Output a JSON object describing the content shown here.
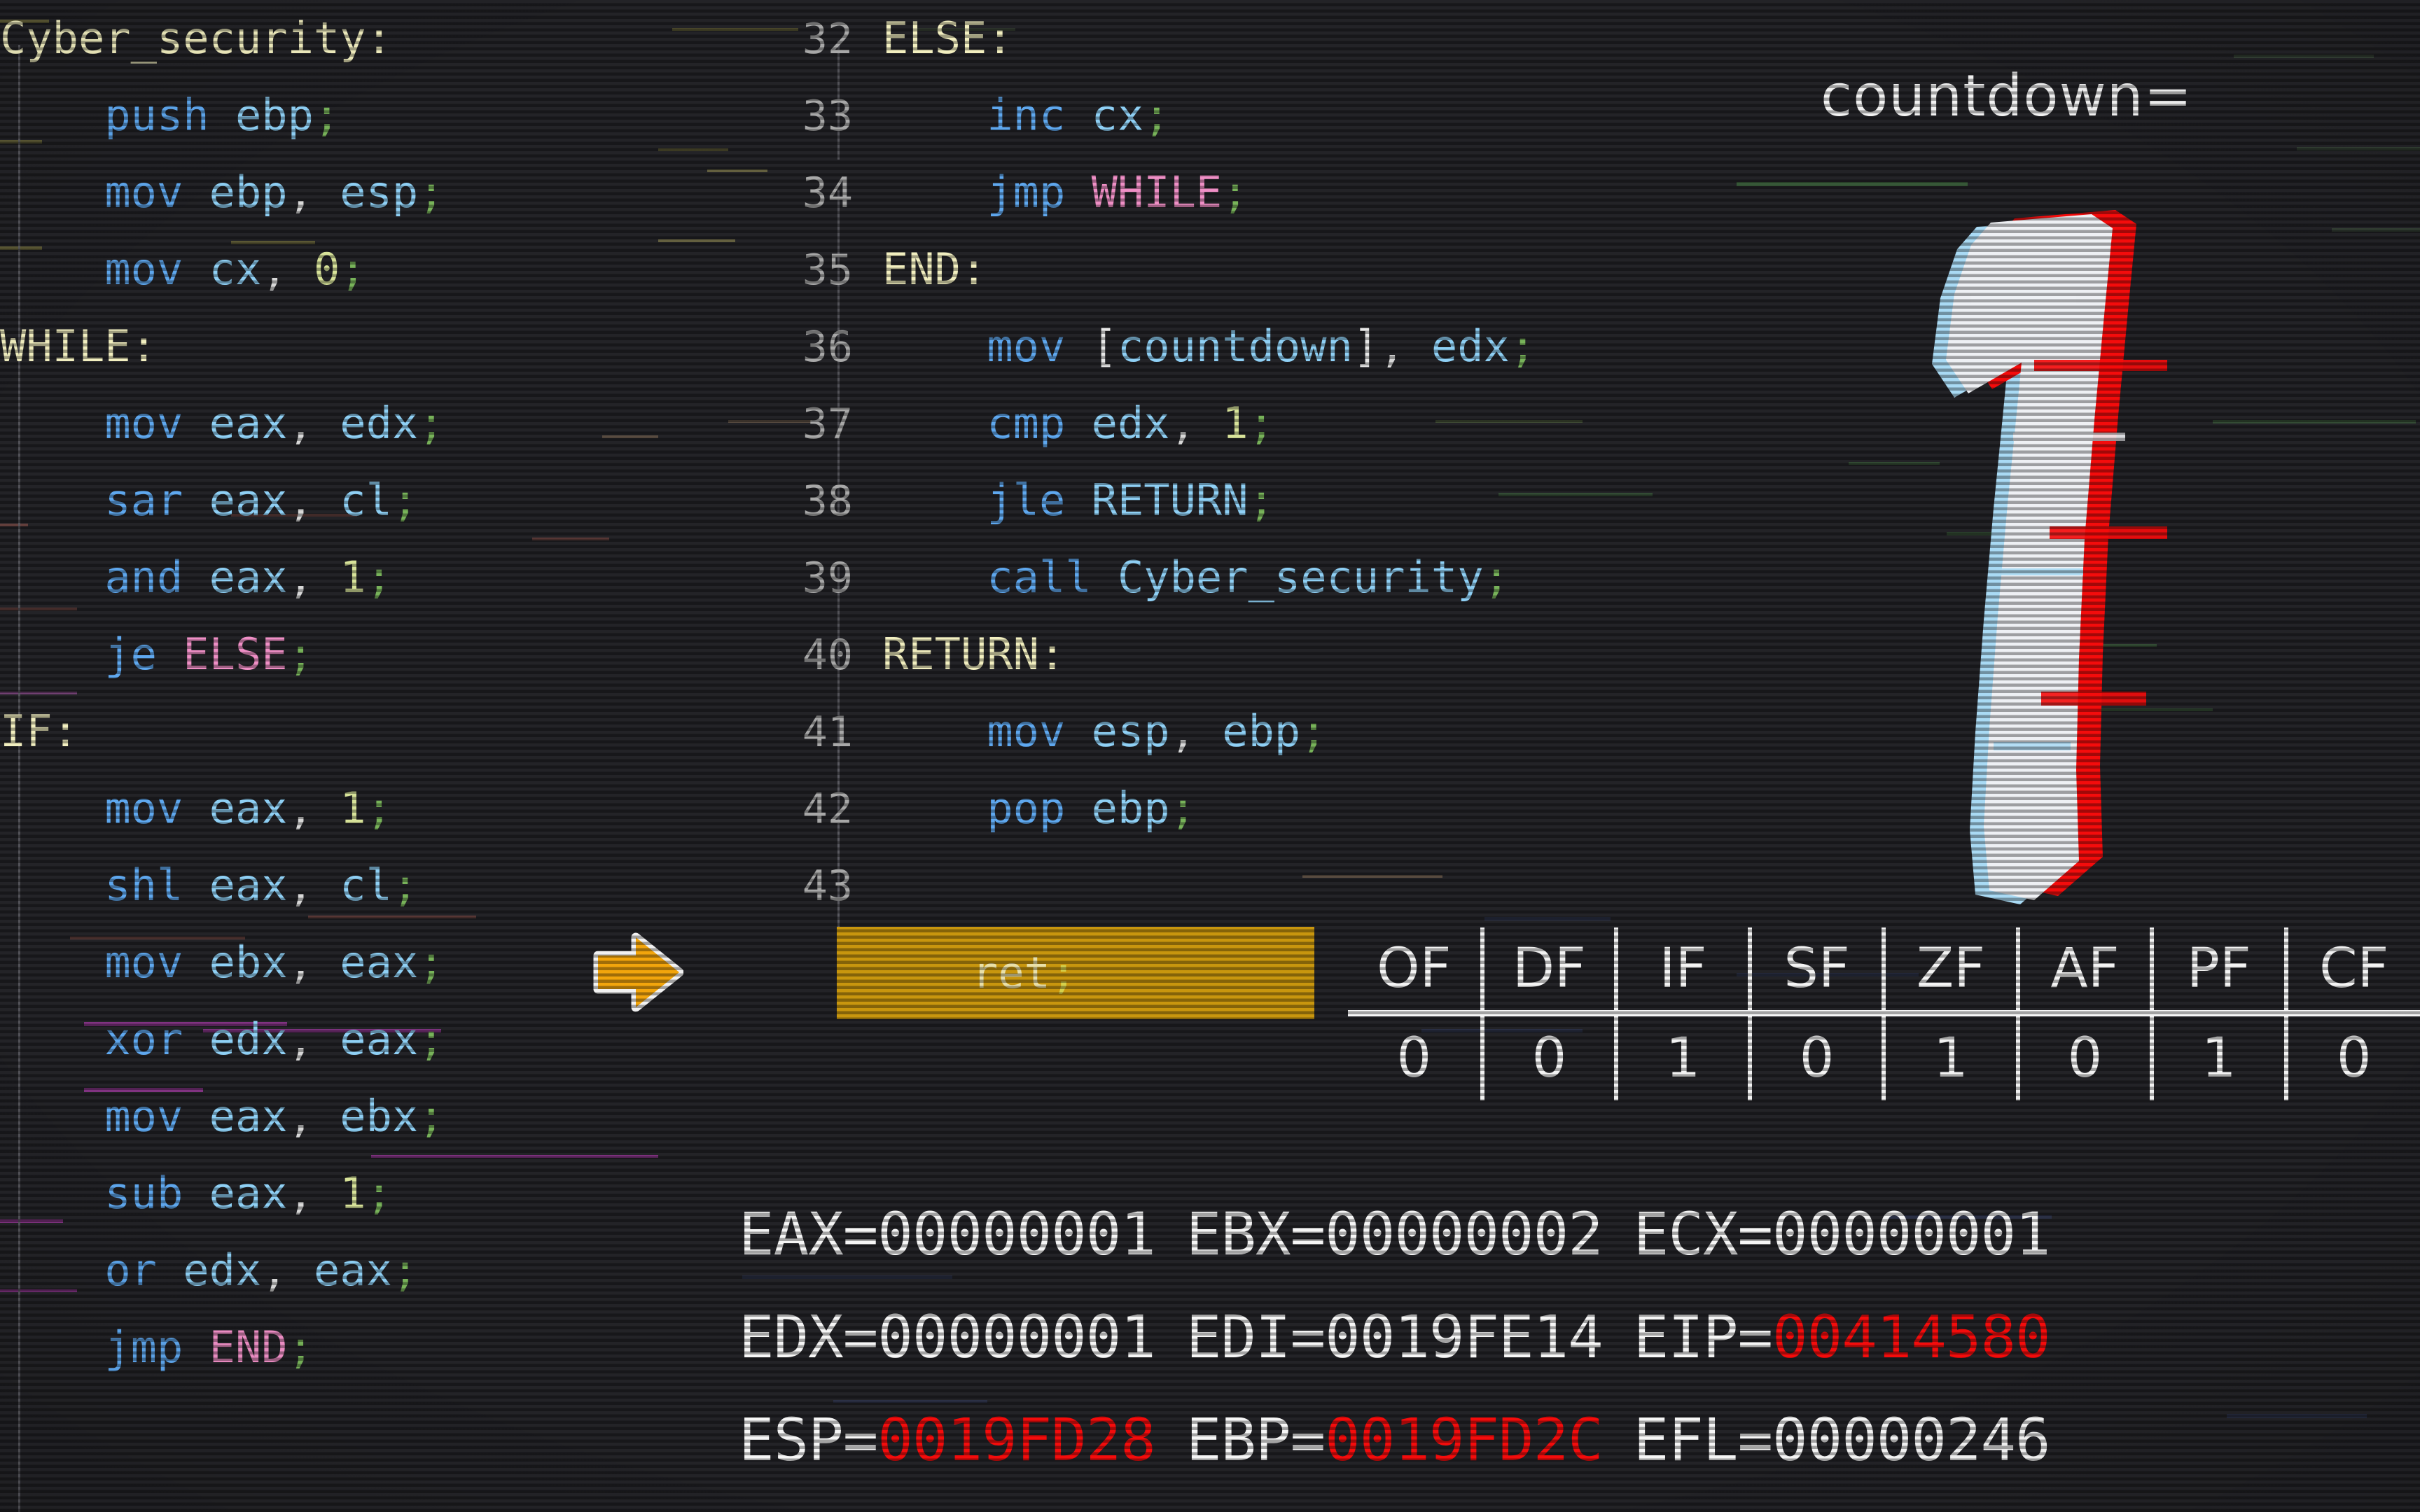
{
  "background": {
    "base_color": "#232327",
    "scanlines": true
  },
  "theme": {
    "label_color": "#f2efc0",
    "mnemonic_color": "#5fa8ef",
    "register_color": "#8fd0f5",
    "number_color": "#d8e39a",
    "semicolon_color": "#78b35a",
    "jump_target_color": "#ef8fc6",
    "line_number_color": "#a8a8a8",
    "exec_highlight_color": "#c8960e",
    "exec_arrow_color": "#f2a50c",
    "register_hot_color": "#f40c0c",
    "register_text_color": "#f6f6f6"
  },
  "code_left": [
    {
      "indent": 0,
      "parts": [
        {
          "t": "Cyber_security:",
          "c": "lbl"
        }
      ]
    },
    {
      "indent": 1,
      "parts": [
        {
          "t": "push ",
          "c": "mn"
        },
        {
          "t": "ebp",
          "c": "reg"
        },
        {
          "t": ";",
          "c": "semi"
        }
      ]
    },
    {
      "indent": 1,
      "parts": [
        {
          "t": "mov ",
          "c": "mn"
        },
        {
          "t": "ebp",
          "c": "reg"
        },
        {
          "t": ",",
          "c": "punct"
        },
        {
          "t": " ",
          "c": "punct"
        },
        {
          "t": "esp",
          "c": "reg"
        },
        {
          "t": ";",
          "c": "semi"
        }
      ]
    },
    {
      "indent": 1,
      "parts": [
        {
          "t": "mov ",
          "c": "mn"
        },
        {
          "t": "cx",
          "c": "reg"
        },
        {
          "t": ",",
          "c": "punct"
        },
        {
          "t": " ",
          "c": "punct"
        },
        {
          "t": "0",
          "c": "num"
        },
        {
          "t": ";",
          "c": "semi"
        }
      ]
    },
    {
      "indent": 0,
      "parts": [
        {
          "t": "WHILE:",
          "c": "lbl"
        }
      ]
    },
    {
      "indent": 1,
      "parts": [
        {
          "t": "mov ",
          "c": "mn"
        },
        {
          "t": "eax",
          "c": "reg"
        },
        {
          "t": ",",
          "c": "punct"
        },
        {
          "t": " ",
          "c": "punct"
        },
        {
          "t": "edx",
          "c": "reg"
        },
        {
          "t": ";",
          "c": "semi"
        }
      ]
    },
    {
      "indent": 1,
      "parts": [
        {
          "t": "sar ",
          "c": "mn"
        },
        {
          "t": "eax",
          "c": "reg"
        },
        {
          "t": ",",
          "c": "punct"
        },
        {
          "t": " ",
          "c": "punct"
        },
        {
          "t": "cl",
          "c": "reg"
        },
        {
          "t": ";",
          "c": "semi"
        }
      ]
    },
    {
      "indent": 1,
      "parts": [
        {
          "t": "and ",
          "c": "mn"
        },
        {
          "t": "eax",
          "c": "reg"
        },
        {
          "t": ",",
          "c": "punct"
        },
        {
          "t": " ",
          "c": "punct"
        },
        {
          "t": "1",
          "c": "num"
        },
        {
          "t": ";",
          "c": "semi"
        }
      ]
    },
    {
      "indent": 1,
      "parts": [
        {
          "t": "je ",
          "c": "mn"
        },
        {
          "t": "ELSE",
          "c": "ref"
        },
        {
          "t": ";",
          "c": "semi"
        }
      ]
    },
    {
      "indent": 0,
      "parts": [
        {
          "t": "IF:",
          "c": "lbl"
        }
      ]
    },
    {
      "indent": 1,
      "parts": [
        {
          "t": "mov ",
          "c": "mn"
        },
        {
          "t": "eax",
          "c": "reg"
        },
        {
          "t": ",",
          "c": "punct"
        },
        {
          "t": " ",
          "c": "punct"
        },
        {
          "t": "1",
          "c": "num"
        },
        {
          "t": ";",
          "c": "semi"
        }
      ]
    },
    {
      "indent": 1,
      "parts": [
        {
          "t": "shl ",
          "c": "mn"
        },
        {
          "t": "eax",
          "c": "reg"
        },
        {
          "t": ",",
          "c": "punct"
        },
        {
          "t": " ",
          "c": "punct"
        },
        {
          "t": "cl",
          "c": "reg"
        },
        {
          "t": ";",
          "c": "semi"
        }
      ]
    },
    {
      "indent": 1,
      "parts": [
        {
          "t": "mov ",
          "c": "mn"
        },
        {
          "t": "ebx",
          "c": "reg"
        },
        {
          "t": ",",
          "c": "punct"
        },
        {
          "t": " ",
          "c": "punct"
        },
        {
          "t": "eax",
          "c": "reg"
        },
        {
          "t": ";",
          "c": "semi"
        }
      ]
    },
    {
      "indent": 1,
      "parts": [
        {
          "t": "xor ",
          "c": "mn"
        },
        {
          "t": "edx",
          "c": "reg"
        },
        {
          "t": ",",
          "c": "punct"
        },
        {
          "t": " ",
          "c": "punct"
        },
        {
          "t": "eax",
          "c": "reg"
        },
        {
          "t": ";",
          "c": "semi"
        }
      ]
    },
    {
      "indent": 1,
      "parts": [
        {
          "t": "mov ",
          "c": "mn"
        },
        {
          "t": "eax",
          "c": "reg"
        },
        {
          "t": ",",
          "c": "punct"
        },
        {
          "t": " ",
          "c": "punct"
        },
        {
          "t": "ebx",
          "c": "reg"
        },
        {
          "t": ";",
          "c": "semi"
        }
      ]
    },
    {
      "indent": 1,
      "parts": [
        {
          "t": "sub ",
          "c": "mn"
        },
        {
          "t": "eax",
          "c": "reg"
        },
        {
          "t": ",",
          "c": "punct"
        },
        {
          "t": " ",
          "c": "punct"
        },
        {
          "t": "1",
          "c": "num"
        },
        {
          "t": ";",
          "c": "semi"
        }
      ]
    },
    {
      "indent": 1,
      "parts": [
        {
          "t": "or ",
          "c": "mn"
        },
        {
          "t": "edx",
          "c": "reg"
        },
        {
          "t": ",",
          "c": "punct"
        },
        {
          "t": " ",
          "c": "punct"
        },
        {
          "t": "eax",
          "c": "reg"
        },
        {
          "t": ";",
          "c": "semi"
        }
      ]
    },
    {
      "indent": 1,
      "parts": [
        {
          "t": "jmp ",
          "c": "mn"
        },
        {
          "t": "END",
          "c": "ref"
        },
        {
          "t": ";",
          "c": "semi"
        }
      ]
    }
  ],
  "code_mid": [
    {
      "n": "32",
      "indent": 0,
      "exec": false,
      "parts": [
        {
          "t": "ELSE:",
          "c": "lbl"
        }
      ]
    },
    {
      "n": "33",
      "indent": 1,
      "exec": false,
      "parts": [
        {
          "t": "inc ",
          "c": "mn"
        },
        {
          "t": "cx",
          "c": "reg"
        },
        {
          "t": ";",
          "c": "semi"
        }
      ]
    },
    {
      "n": "34",
      "indent": 1,
      "exec": false,
      "parts": [
        {
          "t": "jmp ",
          "c": "mn"
        },
        {
          "t": "WHILE",
          "c": "ref"
        },
        {
          "t": ";",
          "c": "semi"
        }
      ]
    },
    {
      "n": "35",
      "indent": 0,
      "exec": false,
      "parts": [
        {
          "t": "END:",
          "c": "lbl"
        }
      ]
    },
    {
      "n": "36",
      "indent": 1,
      "exec": false,
      "parts": [
        {
          "t": "mov ",
          "c": "mn"
        },
        {
          "t": "[",
          "c": "mem"
        },
        {
          "t": "countdown",
          "c": "reg"
        },
        {
          "t": "]",
          "c": "mem"
        },
        {
          "t": ",",
          "c": "punct"
        },
        {
          "t": " ",
          "c": "punct"
        },
        {
          "t": "edx",
          "c": "reg"
        },
        {
          "t": ";",
          "c": "semi"
        }
      ]
    },
    {
      "n": "37",
      "indent": 1,
      "exec": false,
      "parts": [
        {
          "t": "cmp ",
          "c": "mn"
        },
        {
          "t": "edx",
          "c": "reg"
        },
        {
          "t": ",",
          "c": "punct"
        },
        {
          "t": " ",
          "c": "punct"
        },
        {
          "t": "1",
          "c": "num"
        },
        {
          "t": ";",
          "c": "semi"
        }
      ]
    },
    {
      "n": "38",
      "indent": 1,
      "exec": false,
      "parts": [
        {
          "t": "jle ",
          "c": "mn"
        },
        {
          "t": "RETURN",
          "c": "refb"
        },
        {
          "t": ";",
          "c": "semi"
        }
      ]
    },
    {
      "n": "39",
      "indent": 1,
      "exec": false,
      "parts": [
        {
          "t": "call ",
          "c": "mn"
        },
        {
          "t": "Cyber_security",
          "c": "refb"
        },
        {
          "t": ";",
          "c": "semi"
        }
      ]
    },
    {
      "n": "40",
      "indent": 0,
      "exec": false,
      "parts": [
        {
          "t": "RETURN:",
          "c": "lbl"
        }
      ]
    },
    {
      "n": "41",
      "indent": 1,
      "exec": false,
      "parts": [
        {
          "t": "mov ",
          "c": "mn"
        },
        {
          "t": "esp",
          "c": "reg"
        },
        {
          "t": ",",
          "c": "punct"
        },
        {
          "t": " ",
          "c": "punct"
        },
        {
          "t": "ebp",
          "c": "reg"
        },
        {
          "t": ";",
          "c": "semi"
        }
      ]
    },
    {
      "n": "42",
      "indent": 1,
      "exec": false,
      "parts": [
        {
          "t": "pop ",
          "c": "mn"
        },
        {
          "t": "ebp",
          "c": "reg"
        },
        {
          "t": ";",
          "c": "semi"
        }
      ]
    },
    {
      "n": "43",
      "indent": 1,
      "exec": true,
      "parts": []
    }
  ],
  "exec_line": {
    "number": "43",
    "text": "ret",
    "semicolon": ";"
  },
  "countdown": {
    "label": "countdown=",
    "value": "1"
  },
  "flags": {
    "names": [
      "OF",
      "DF",
      "IF",
      "SF",
      "ZF",
      "AF",
      "PF",
      "CF"
    ],
    "values": [
      "0",
      "0",
      "1",
      "0",
      "1",
      "0",
      "1",
      "0"
    ]
  },
  "registers": [
    [
      {
        "name": "EAX=",
        "value": "00000001",
        "hot": false
      },
      {
        "name": "EBX=",
        "value": "00000002",
        "hot": false
      },
      {
        "name": "ECX=",
        "value": "00000001",
        "hot": false
      }
    ],
    [
      {
        "name": "EDX=",
        "value": "00000001",
        "hot": false
      },
      {
        "name": "EDI=",
        "value": "0019FE14",
        "hot": false
      },
      {
        "name": "EIP=",
        "value": "00414580",
        "hot": true
      }
    ],
    [
      {
        "name": "ESP=",
        "value": "0019FD28",
        "hot": true
      },
      {
        "name": "EBP=",
        "value": "0019FD2C",
        "hot": true
      },
      {
        "name": "EFL=",
        "value": "00000246",
        "hot": false
      }
    ]
  ]
}
